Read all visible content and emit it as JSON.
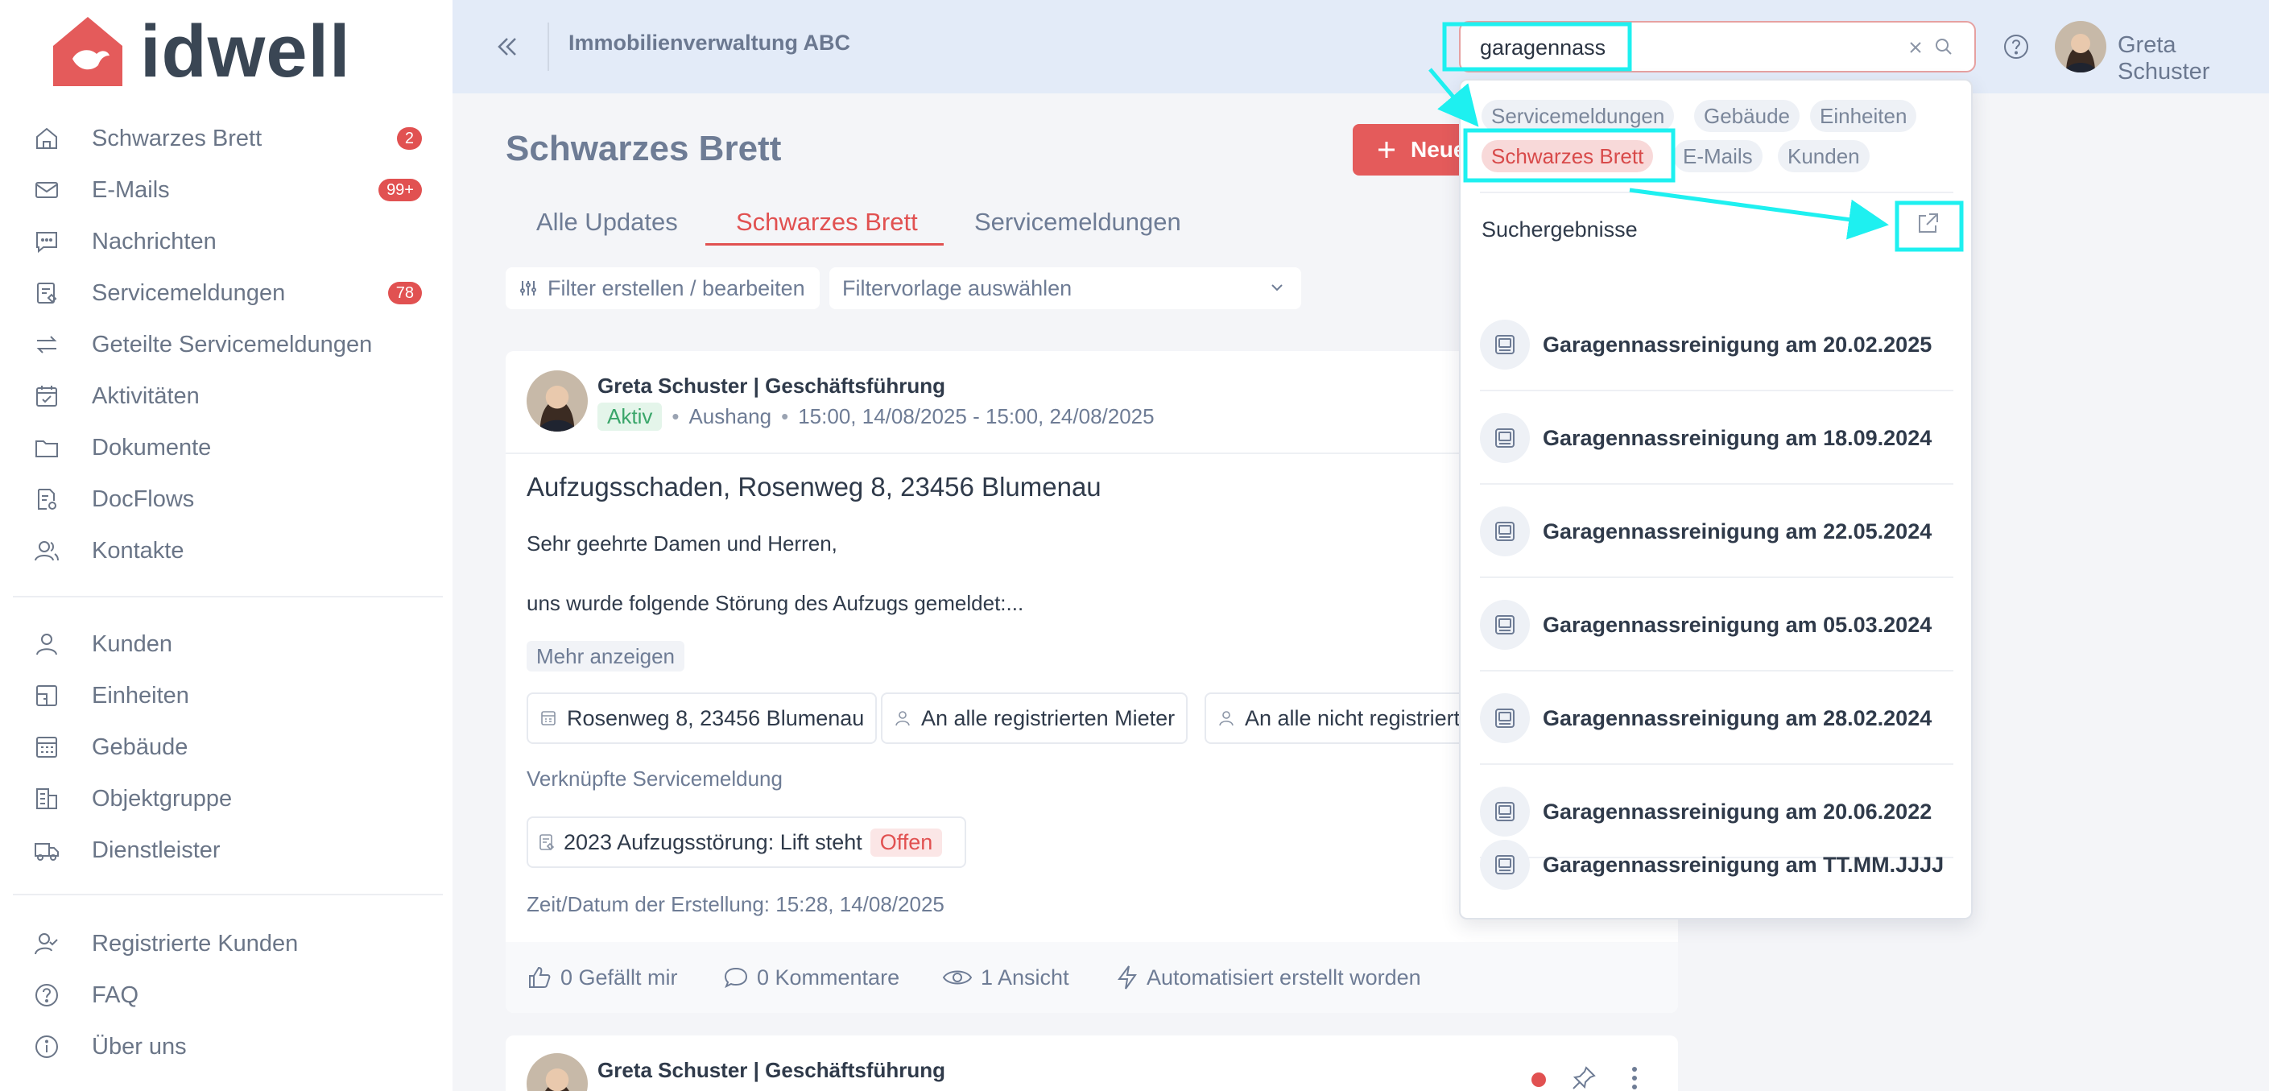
{
  "brand": {
    "name": "idwell",
    "accent": "#e15151"
  },
  "sidebar": {
    "items": [
      {
        "label": "Schwarzes Brett",
        "icon": "home-icon",
        "badge": "2"
      },
      {
        "label": "E-Mails",
        "icon": "mail-icon",
        "badge": "99+"
      },
      {
        "label": "Nachrichten",
        "icon": "chat-icon",
        "badge": ""
      },
      {
        "label": "Servicemeldungen",
        "icon": "service-report-icon",
        "badge": "78"
      },
      {
        "label": "Geteilte Servicemeldungen",
        "icon": "arrows-exchange-icon",
        "badge": ""
      },
      {
        "label": "Aktivitäten",
        "icon": "calendar-icon",
        "badge": ""
      },
      {
        "label": "Dokumente",
        "icon": "folder-icon",
        "badge": ""
      },
      {
        "label": "DocFlows",
        "icon": "docflow-icon",
        "badge": ""
      },
      {
        "label": "Kontakte",
        "icon": "contacts-icon",
        "badge": ""
      }
    ],
    "items2": [
      {
        "label": "Kunden",
        "icon": "user-icon"
      },
      {
        "label": "Einheiten",
        "icon": "unit-icon"
      },
      {
        "label": "Gebäude",
        "icon": "building-icon"
      },
      {
        "label": "Objektgruppe",
        "icon": "building-group-icon"
      },
      {
        "label": "Dienstleister",
        "icon": "truck-icon"
      }
    ],
    "items3": [
      {
        "label": "Registrierte Kunden",
        "icon": "registered-user-icon"
      },
      {
        "label": "FAQ",
        "icon": "question-icon"
      },
      {
        "label": "Über uns",
        "icon": "info-icon"
      }
    ]
  },
  "header": {
    "org_name": "Immobilienverwaltung ABC",
    "search_value": "garagennass",
    "user_name": "Greta Schuster"
  },
  "main": {
    "title": "Schwarzes Brett",
    "new_button": "Neue",
    "tabs": [
      "Alle Updates",
      "Schwarzes Brett",
      "Servicemeldungen"
    ],
    "active_tab": "Schwarzes Brett",
    "filter_button": "Filter erstellen / bearbeiten",
    "template_select": "Filtervorlage auswählen"
  },
  "post": {
    "author": "Greta Schuster | Geschäftsführung",
    "status": "Aktiv",
    "type": "Aushang",
    "period": "15:00, 14/08/2025 - 15:00, 24/08/2025",
    "title": "Aufzugsschaden, Rosenweg 8, 23456 Blumenau",
    "body_1": "Sehr geehrte Damen und Herren,",
    "body_2": "uns wurde folgende Störung des Aufzugs gemeldet:...",
    "more": "Mehr anzeigen",
    "chips": [
      "Rosenweg 8, 23456 Blumenau",
      "An alle registrierten Mieter",
      "An alle nicht registrierten"
    ],
    "linked_label": "Verknüpfte Servicemeldung",
    "linked_item": "2023 Aufzugsstörung: Lift steht",
    "linked_status": "Offen",
    "created_at": "Zeit/Datum der Erstellung: 15:28, 14/08/2025",
    "likes": "0 Gefällt mir",
    "comments": "0 Kommentare",
    "views": "1 Ansicht",
    "automated": "Automatisiert erstellt worden"
  },
  "post2": {
    "author": "Greta Schuster | Geschäftsführung"
  },
  "search_dropdown": {
    "filters": [
      {
        "label": "Servicemeldungen",
        "active": false
      },
      {
        "label": "Gebäude",
        "active": false
      },
      {
        "label": "Einheiten",
        "active": false
      },
      {
        "label": "Schwarzes Brett",
        "active": true
      },
      {
        "label": "E-Mails",
        "active": false
      },
      {
        "label": "Kunden",
        "active": false
      }
    ],
    "heading": "Suchergebnisse",
    "results": [
      "Garagennassreinigung am 20.02.2025",
      "Garagennassreinigung am 18.09.2024",
      "Garagennassreinigung am 22.05.2024",
      "Garagennassreinigung am 05.03.2024",
      "Garagennassreinigung am 28.02.2024",
      "Garagennassreinigung am 20.06.2022",
      "Garagennassreinigung am TT.MM.JJJJ"
    ]
  },
  "annotation_color": "#1ef0f0"
}
